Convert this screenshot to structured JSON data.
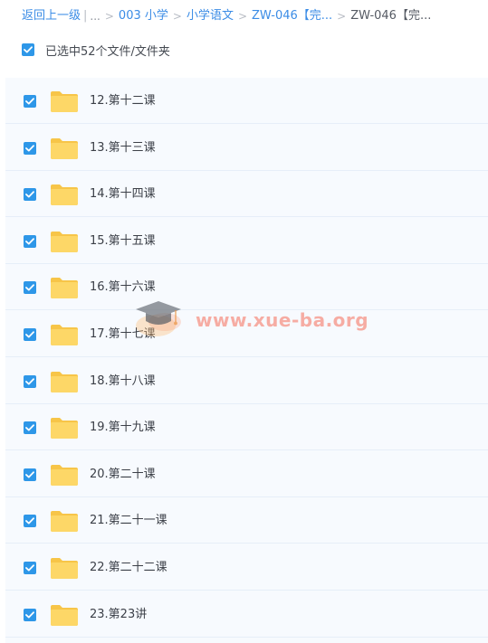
{
  "breadcrumb": {
    "back_label": "返回上一级",
    "pipe": "|",
    "ellipsis": "...",
    "separator": ">",
    "items": [
      "003 小学",
      "小学语文",
      "ZW-046【完..."
    ],
    "current": "ZW-046【完..."
  },
  "selection": {
    "summary": "已选中52个文件/文件夹",
    "all_checked": true
  },
  "files": [
    {
      "name": "12.第十二课",
      "checked": true
    },
    {
      "name": "13.第十三课",
      "checked": true
    },
    {
      "name": "14.第十四课",
      "checked": true
    },
    {
      "name": "15.第十五课",
      "checked": true
    },
    {
      "name": "16.第十六课",
      "checked": true
    },
    {
      "name": "17.第十七课",
      "checked": true
    },
    {
      "name": "18.第十八课",
      "checked": true
    },
    {
      "name": "19.第十九课",
      "checked": true
    },
    {
      "name": "20.第二十课",
      "checked": true
    },
    {
      "name": "21.第二十一课",
      "checked": true
    },
    {
      "name": "22.第二十二课",
      "checked": true
    },
    {
      "name": "23.第23讲",
      "checked": true
    }
  ],
  "watermark": {
    "text": "www.xue-ba.org",
    "icon": "graduation-cap-icon"
  },
  "colors": {
    "link": "#3b8ce6",
    "checkbox": "#2e97e8",
    "folder": "#fcd35a",
    "list_bg": "#f7fafe"
  },
  "icons": {
    "checkbox": "checkmark-icon",
    "folder": "folder-icon"
  }
}
